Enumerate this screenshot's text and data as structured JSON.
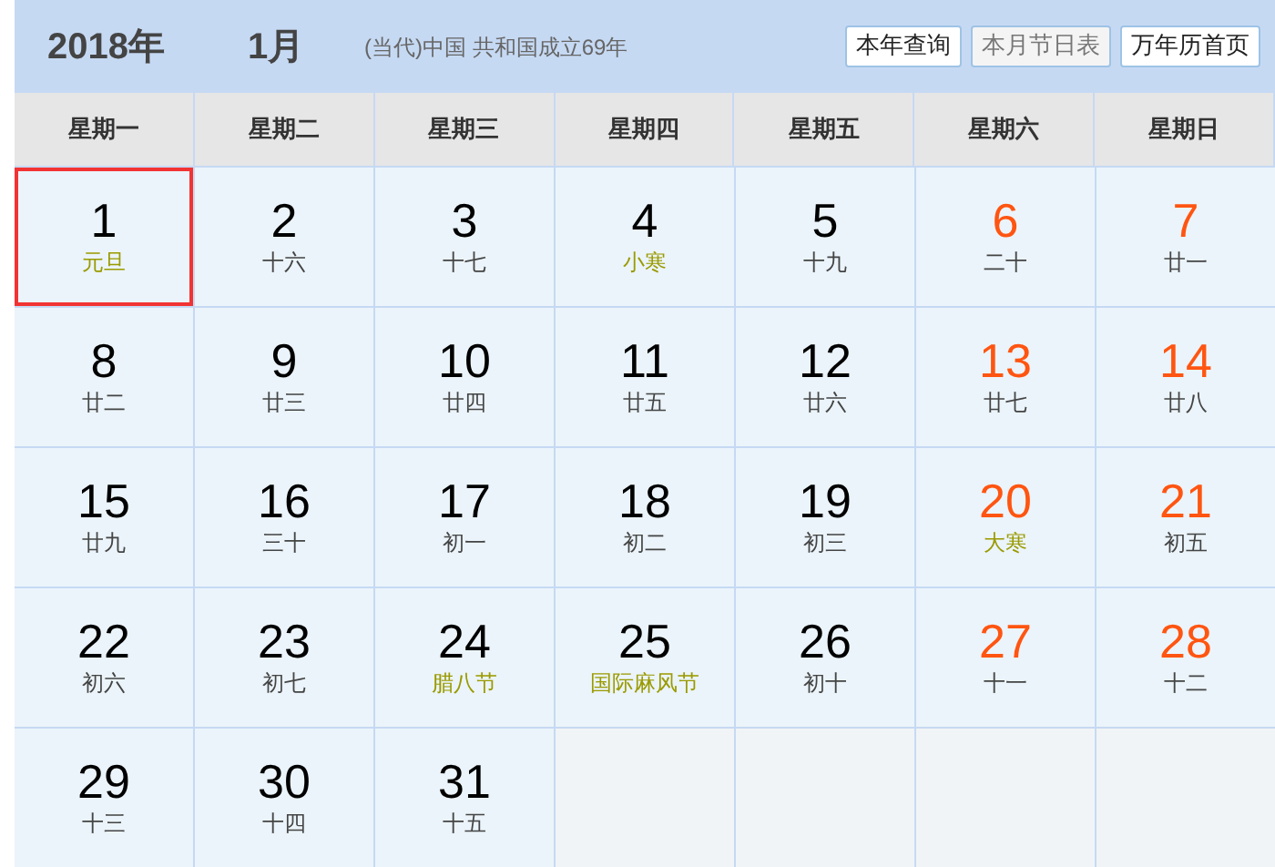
{
  "header": {
    "year": "2018年",
    "month": "1月",
    "note": "(当代)中国 共和国成立69年"
  },
  "buttons": [
    {
      "label": "本年查询",
      "disabled": false
    },
    {
      "label": "本月节日表",
      "disabled": true
    },
    {
      "label": "万年历首页",
      "disabled": false
    }
  ],
  "weekdays": [
    "星期一",
    "星期二",
    "星期三",
    "星期四",
    "星期五",
    "星期六",
    "星期日"
  ],
  "days": [
    {
      "day": "1",
      "lunar": "元旦",
      "weekend": false,
      "festival": true,
      "selected": true
    },
    {
      "day": "2",
      "lunar": "十六",
      "weekend": false,
      "festival": false,
      "selected": false
    },
    {
      "day": "3",
      "lunar": "十七",
      "weekend": false,
      "festival": false,
      "selected": false
    },
    {
      "day": "4",
      "lunar": "小寒",
      "weekend": false,
      "festival": true,
      "selected": false
    },
    {
      "day": "5",
      "lunar": "十九",
      "weekend": false,
      "festival": false,
      "selected": false
    },
    {
      "day": "6",
      "lunar": "二十",
      "weekend": true,
      "festival": false,
      "selected": false
    },
    {
      "day": "7",
      "lunar": "廿一",
      "weekend": true,
      "festival": false,
      "selected": false
    },
    {
      "day": "8",
      "lunar": "廿二",
      "weekend": false,
      "festival": false,
      "selected": false
    },
    {
      "day": "9",
      "lunar": "廿三",
      "weekend": false,
      "festival": false,
      "selected": false
    },
    {
      "day": "10",
      "lunar": "廿四",
      "weekend": false,
      "festival": false,
      "selected": false
    },
    {
      "day": "11",
      "lunar": "廿五",
      "weekend": false,
      "festival": false,
      "selected": false
    },
    {
      "day": "12",
      "lunar": "廿六",
      "weekend": false,
      "festival": false,
      "selected": false
    },
    {
      "day": "13",
      "lunar": "廿七",
      "weekend": true,
      "festival": false,
      "selected": false
    },
    {
      "day": "14",
      "lunar": "廿八",
      "weekend": true,
      "festival": false,
      "selected": false
    },
    {
      "day": "15",
      "lunar": "廿九",
      "weekend": false,
      "festival": false,
      "selected": false
    },
    {
      "day": "16",
      "lunar": "三十",
      "weekend": false,
      "festival": false,
      "selected": false
    },
    {
      "day": "17",
      "lunar": "初一",
      "weekend": false,
      "festival": false,
      "selected": false
    },
    {
      "day": "18",
      "lunar": "初二",
      "weekend": false,
      "festival": false,
      "selected": false
    },
    {
      "day": "19",
      "lunar": "初三",
      "weekend": false,
      "festival": false,
      "selected": false
    },
    {
      "day": "20",
      "lunar": "大寒",
      "weekend": true,
      "festival": true,
      "selected": false
    },
    {
      "day": "21",
      "lunar": "初五",
      "weekend": true,
      "festival": false,
      "selected": false
    },
    {
      "day": "22",
      "lunar": "初六",
      "weekend": false,
      "festival": false,
      "selected": false
    },
    {
      "day": "23",
      "lunar": "初七",
      "weekend": false,
      "festival": false,
      "selected": false
    },
    {
      "day": "24",
      "lunar": "腊八节",
      "weekend": false,
      "festival": true,
      "selected": false
    },
    {
      "day": "25",
      "lunar": "国际麻风节",
      "weekend": false,
      "festival": true,
      "selected": false
    },
    {
      "day": "26",
      "lunar": "初十",
      "weekend": false,
      "festival": false,
      "selected": false
    },
    {
      "day": "27",
      "lunar": "十一",
      "weekend": true,
      "festival": false,
      "selected": false
    },
    {
      "day": "28",
      "lunar": "十二",
      "weekend": true,
      "festival": false,
      "selected": false
    },
    {
      "day": "29",
      "lunar": "十三",
      "weekend": false,
      "festival": false,
      "selected": false
    },
    {
      "day": "30",
      "lunar": "十四",
      "weekend": false,
      "festival": false,
      "selected": false
    },
    {
      "day": "31",
      "lunar": "十五",
      "weekend": false,
      "festival": false,
      "selected": false
    }
  ]
}
